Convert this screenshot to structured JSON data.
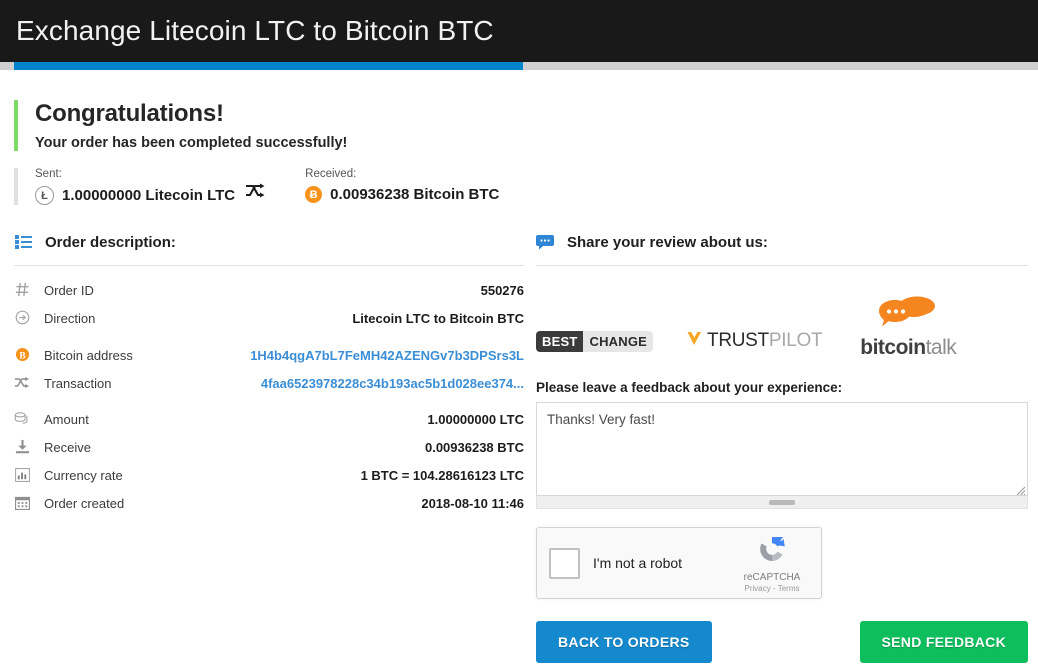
{
  "header": {
    "title": "Exchange Litecoin LTC to Bitcoin BTC"
  },
  "progress": {
    "percent": 49,
    "fill_color": "#0383cc",
    "track_color": "#d0d0d0"
  },
  "status": {
    "title": "Congratulations!",
    "subtitle": "Your order has been completed successfully!",
    "accent_color": "#7ddb68"
  },
  "amounts": {
    "sent": {
      "label": "Sent:",
      "icon": "litecoin-icon",
      "glyph": "Ł",
      "value": "1.00000000 Litecoin LTC"
    },
    "swap_icon": "swap-arrows-icon",
    "received": {
      "label": "Received:",
      "icon": "bitcoin-icon",
      "glyph": "Ƀ",
      "value": "0.00936238 Bitcoin BTC"
    }
  },
  "order": {
    "heading": "Order description:",
    "heading_icon": "list-icon",
    "rows": [
      {
        "icon": "hash-icon",
        "label": "Order ID",
        "value": "550276",
        "link": false,
        "gap": false
      },
      {
        "icon": "arrow-circle-icon",
        "label": "Direction",
        "value": "Litecoin LTC to Bitcoin BTC",
        "link": false,
        "gap": false
      },
      {
        "icon": "bitcoin-icon",
        "label": "Bitcoin address",
        "value": "1H4b4qgA7bL7FeMH42AZENGv7b3DPSrs3L",
        "link": true,
        "gap": true
      },
      {
        "icon": "shuffle-icon",
        "label": "Transaction",
        "value": "4faa6523978228c34b193ac5b1d028ee374...",
        "link": true,
        "gap": false
      },
      {
        "icon": "money-icon",
        "label": "Amount",
        "value": "1.00000000 LTC",
        "link": false,
        "gap": true
      },
      {
        "icon": "download-icon",
        "label": "Receive",
        "value": "0.00936238 BTC",
        "link": false,
        "gap": false
      },
      {
        "icon": "chart-icon",
        "label": "Currency rate",
        "value": "1 BTC = 104.28616123 LTC",
        "link": false,
        "gap": false
      },
      {
        "icon": "calendar-icon",
        "label": "Order created",
        "value": "2018-08-10 11:46",
        "link": false,
        "gap": false
      }
    ]
  },
  "review": {
    "heading": "Share your review about us:",
    "heading_icon": "comment-icon",
    "logos": {
      "bestchange": {
        "part1": "BEST",
        "part2": "CHANGE"
      },
      "trustpilot": {
        "part1": "TRUST",
        "part2": "PILOT"
      },
      "bitcointalk": {
        "part1": "bitcoin",
        "part2": "talk"
      }
    },
    "feedback_label": "Please leave a feedback about your experience:",
    "feedback_value": "Thanks! Very fast!",
    "feedback_placeholder": ""
  },
  "recaptcha": {
    "label": "I'm not a robot",
    "brand": "reCAPTCHA",
    "legal": "Privacy - Terms",
    "checked": false
  },
  "buttons": {
    "back": "BACK TO ORDERS",
    "send": "SEND FEEDBACK",
    "back_color": "#1589ce",
    "send_color": "#0ebe5d"
  }
}
